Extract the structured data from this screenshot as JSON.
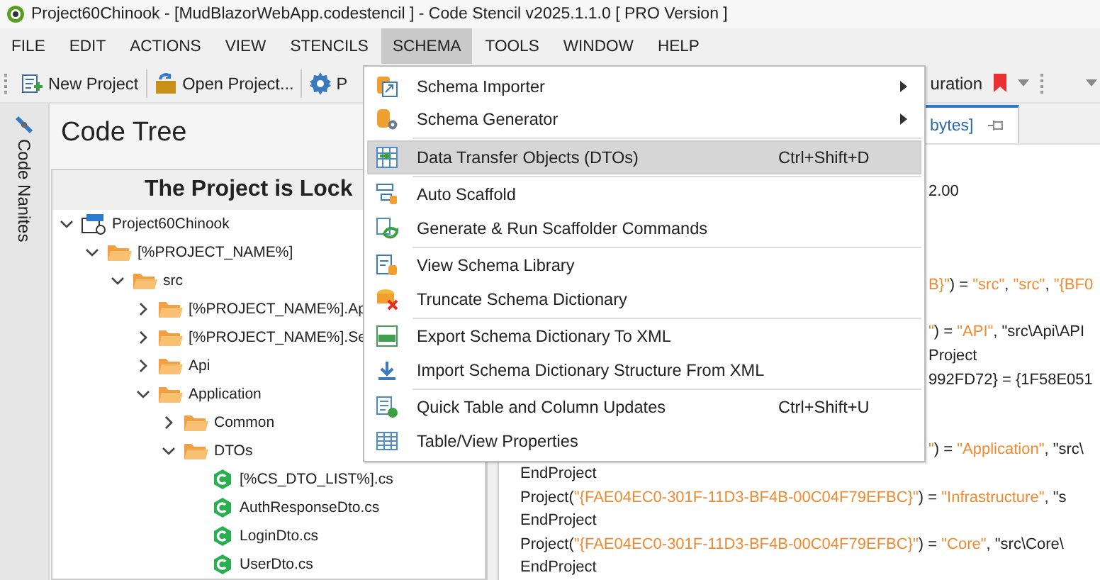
{
  "window": {
    "title": "Project60Chinook -  [MudBlazorWebApp.codestencil ] - Code Stencil v2025.1.1.0 [ PRO Version ]"
  },
  "menubar": [
    {
      "label": "FILE",
      "selected": false
    },
    {
      "label": "EDIT",
      "selected": false
    },
    {
      "label": "ACTIONS",
      "selected": false
    },
    {
      "label": "VIEW",
      "selected": false
    },
    {
      "label": "STENCILS",
      "selected": false
    },
    {
      "label": "SCHEMA",
      "selected": true
    },
    {
      "label": "TOOLS",
      "selected": false
    },
    {
      "label": "WINDOW",
      "selected": false
    },
    {
      "label": "HELP",
      "selected": false
    }
  ],
  "toolbar": {
    "left": [
      {
        "kind": "new",
        "label": "New Project"
      },
      {
        "kind": "open",
        "label": "Open Project..."
      },
      {
        "kind": "gear",
        "label": "P"
      }
    ],
    "right_label": "uration"
  },
  "side_tab": {
    "label": "Code Nanites"
  },
  "code_tree": {
    "title": "Code Tree",
    "banner": "The Project is Lock",
    "items": [
      {
        "kind": "project",
        "label": "Project60Chinook",
        "expanded": true,
        "children": [
          {
            "kind": "folder",
            "label": "[%PROJECT_NAME%]",
            "expanded": true,
            "children": [
              {
                "kind": "folder",
                "label": "src",
                "expanded": true,
                "children": [
                  {
                    "kind": "folder",
                    "label": "[%PROJECT_NAME%].Ap",
                    "expanded": false
                  },
                  {
                    "kind": "folder",
                    "label": "[%PROJECT_NAME%].Se",
                    "expanded": false
                  },
                  {
                    "kind": "folder",
                    "label": "Api",
                    "expanded": false
                  },
                  {
                    "kind": "folder",
                    "label": "Application",
                    "expanded": true,
                    "children": [
                      {
                        "kind": "folder",
                        "label": "Common",
                        "expanded": false
                      },
                      {
                        "kind": "folder",
                        "label": "DTOs",
                        "expanded": true,
                        "children": [
                          {
                            "kind": "file",
                            "label": "[%CS_DTO_LIST%].cs"
                          },
                          {
                            "kind": "file",
                            "label": "AuthResponseDto.cs"
                          },
                          {
                            "kind": "file",
                            "label": "LoginDto.cs"
                          },
                          {
                            "kind": "file",
                            "label": "UserDto.cs"
                          }
                        ]
                      }
                    ]
                  }
                ]
              }
            ]
          }
        ]
      }
    ]
  },
  "editor": {
    "tab": "bytes]",
    "lines": [
      {
        "kind": "blank"
      },
      {
        "kind": "partial",
        "segments": [
          {
            "kind": "plain",
            "text": "2.00"
          }
        ]
      },
      {
        "kind": "blank"
      },
      {
        "kind": "blank"
      },
      {
        "kind": "blank"
      },
      {
        "kind": "partial",
        "segments": [
          {
            "kind": "string",
            "text": "B}\""
          },
          {
            "kind": "plain",
            "text": ") = "
          },
          {
            "kind": "string",
            "text": "\"src\""
          },
          {
            "kind": "plain",
            "text": ", "
          },
          {
            "kind": "string",
            "text": "\"src\""
          },
          {
            "kind": "plain",
            "text": ", "
          },
          {
            "kind": "string",
            "text": "\"{BF0"
          }
        ]
      },
      {
        "kind": "blank"
      },
      {
        "kind": "partial",
        "segments": [
          {
            "kind": "string",
            "text": "\""
          },
          {
            "kind": "plain",
            "text": ") = "
          },
          {
            "kind": "string",
            "text": "\"API\""
          },
          {
            "kind": "plain",
            "text": ", \"src\\Api\\API"
          }
        ]
      },
      {
        "kind": "partial",
        "segments": [
          {
            "kind": "plain",
            "text": "Project"
          }
        ]
      },
      {
        "kind": "partial",
        "segments": [
          {
            "kind": "plain",
            "text": "992FD72} = {1F58E051"
          }
        ]
      },
      {
        "kind": "blank"
      },
      {
        "kind": "blank"
      },
      {
        "kind": "partial",
        "segments": [
          {
            "kind": "string",
            "text": "\""
          },
          {
            "kind": "plain",
            "text": ") = "
          },
          {
            "kind": "string",
            "text": "\"Application\""
          },
          {
            "kind": "plain",
            "text": ", \"src\\"
          }
        ]
      },
      {
        "kind": "full",
        "segments": [
          {
            "kind": "plain",
            "text": "EndProject"
          }
        ]
      },
      {
        "kind": "full",
        "segments": [
          {
            "kind": "plain",
            "text": "Project("
          },
          {
            "kind": "string",
            "text": "\"{FAE04EC0-301F-11D3-BF4B-00C04F79EFBC}\""
          },
          {
            "kind": "plain",
            "text": ") = "
          },
          {
            "kind": "string",
            "text": "\"Infrastructure\""
          },
          {
            "kind": "plain",
            "text": ", \"s"
          }
        ]
      },
      {
        "kind": "full",
        "segments": [
          {
            "kind": "plain",
            "text": "EndProject"
          }
        ]
      },
      {
        "kind": "full",
        "segments": [
          {
            "kind": "plain",
            "text": "Project("
          },
          {
            "kind": "string",
            "text": "\"{FAE04EC0-301F-11D3-BF4B-00C04F79EFBC}\""
          },
          {
            "kind": "plain",
            "text": ") = "
          },
          {
            "kind": "string",
            "text": "\"Core\""
          },
          {
            "kind": "plain",
            "text": ", \"src\\Core\\"
          }
        ]
      },
      {
        "kind": "full",
        "segments": [
          {
            "kind": "plain",
            "text": "EndProject"
          }
        ]
      }
    ]
  },
  "schema_menu": {
    "groups": [
      [
        {
          "label": "Schema Importer",
          "submenu": true,
          "selected": false
        },
        {
          "label": "Schema Generator",
          "submenu": true,
          "selected": false
        }
      ],
      [
        {
          "label": "Data Transfer Objects (DTOs)",
          "shortcut": "Ctrl+Shift+D",
          "submenu": false,
          "selected": true
        }
      ],
      [
        {
          "label": "Auto Scaffold",
          "submenu": false,
          "selected": false
        },
        {
          "label": "Generate & Run Scaffolder Commands",
          "submenu": false,
          "selected": false
        }
      ],
      [
        {
          "label": "View Schema Library",
          "submenu": false,
          "selected": false
        },
        {
          "label": "Truncate Schema Dictionary",
          "submenu": false,
          "selected": false
        }
      ],
      [
        {
          "label": "Export Schema Dictionary To XML",
          "submenu": false,
          "selected": false
        },
        {
          "label": "Import Schema Dictionary Structure From XML",
          "submenu": false,
          "selected": false
        }
      ],
      [
        {
          "label": "Quick Table and Column Updates",
          "shortcut": "Ctrl+Shift+U",
          "submenu": false,
          "selected": false
        },
        {
          "label": "Table/View Properties",
          "submenu": false,
          "selected": false
        }
      ]
    ]
  }
}
